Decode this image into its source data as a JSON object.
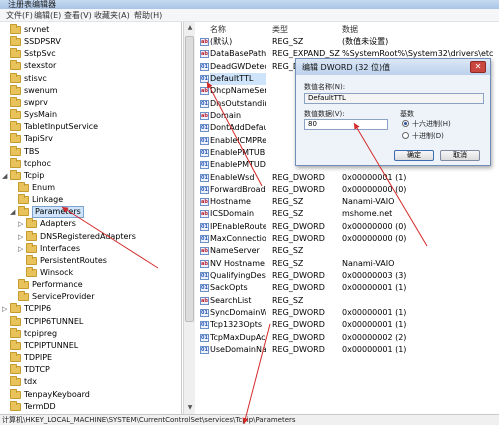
{
  "window": {
    "title": "注册表编辑器"
  },
  "menu": [
    "文件(F)",
    "编辑(E)",
    "查看(V)",
    "收藏夹(A)",
    "帮助(H)"
  ],
  "tree": [
    {
      "label": "srvnet",
      "depth": 0,
      "arrow": ""
    },
    {
      "label": "SSDPSRV",
      "depth": 0,
      "arrow": ""
    },
    {
      "label": "SstpSvc",
      "depth": 0,
      "arrow": ""
    },
    {
      "label": "stexstor",
      "depth": 0,
      "arrow": ""
    },
    {
      "label": "stisvc",
      "depth": 0,
      "arrow": ""
    },
    {
      "label": "swenum",
      "depth": 0,
      "arrow": ""
    },
    {
      "label": "swprv",
      "depth": 0,
      "arrow": ""
    },
    {
      "label": "SysMain",
      "depth": 0,
      "arrow": ""
    },
    {
      "label": "TabletInputService",
      "depth": 0,
      "arrow": ""
    },
    {
      "label": "TapiSrv",
      "depth": 0,
      "arrow": ""
    },
    {
      "label": "TBS",
      "depth": 0,
      "arrow": ""
    },
    {
      "label": "tcphoc",
      "depth": 0,
      "arrow": ""
    },
    {
      "label": "Tcpip",
      "depth": 0,
      "arrow": "◢"
    },
    {
      "label": "Enum",
      "depth": 1,
      "arrow": ""
    },
    {
      "label": "Linkage",
      "depth": 1,
      "arrow": ""
    },
    {
      "label": "Parameters",
      "depth": 1,
      "arrow": "◢",
      "selected": true
    },
    {
      "label": "Adapters",
      "depth": 2,
      "arrow": "▷"
    },
    {
      "label": "DNSRegisteredAdapters",
      "depth": 2,
      "arrow": "▷"
    },
    {
      "label": "Interfaces",
      "depth": 2,
      "arrow": "▷"
    },
    {
      "label": "PersistentRoutes",
      "depth": 2,
      "arrow": ""
    },
    {
      "label": "Winsock",
      "depth": 2,
      "arrow": ""
    },
    {
      "label": "Performance",
      "depth": 1,
      "arrow": ""
    },
    {
      "label": "ServiceProvider",
      "depth": 1,
      "arrow": ""
    },
    {
      "label": "TCPIP6",
      "depth": 0,
      "arrow": "▷"
    },
    {
      "label": "TCPIP6TUNNEL",
      "depth": 0,
      "arrow": ""
    },
    {
      "label": "tcpipreg",
      "depth": 0,
      "arrow": ""
    },
    {
      "label": "TCPIPTUNNEL",
      "depth": 0,
      "arrow": ""
    },
    {
      "label": "TDPIPE",
      "depth": 0,
      "arrow": ""
    },
    {
      "label": "TDTCP",
      "depth": 0,
      "arrow": ""
    },
    {
      "label": "tdx",
      "depth": 0,
      "arrow": ""
    },
    {
      "label": "TenpayKeyboard",
      "depth": 0,
      "arrow": ""
    },
    {
      "label": "TermDD",
      "depth": 0,
      "arrow": ""
    }
  ],
  "list": {
    "headers": {
      "name": "名称",
      "type": "类型",
      "data": "数据"
    },
    "rows": [
      {
        "name": "(默认)",
        "type": "REG_SZ",
        "data": "(数值未设置)",
        "icon": "ab"
      },
      {
        "name": "DataBasePath",
        "type": "REG_EXPAND_SZ",
        "data": "%SystemRoot%\\System32\\drivers\\etc",
        "icon": "ab"
      },
      {
        "name": "DeadGWDetec...",
        "type": "REG_DWORD",
        "data": "",
        "icon": "bin"
      },
      {
        "name": "DefaultTTL",
        "type": "",
        "data": "",
        "icon": "bin",
        "selected": true
      },
      {
        "name": "DhcpNameSer...",
        "type": "",
        "data": "",
        "icon": "ab"
      },
      {
        "name": "DnsOutstandin...",
        "type": "",
        "data": "",
        "icon": "bin"
      },
      {
        "name": "Domain",
        "type": "",
        "data": "",
        "icon": "ab"
      },
      {
        "name": "DontAddDefau...",
        "type": "",
        "data": "",
        "icon": "bin"
      },
      {
        "name": "EnableICMPRe...",
        "type": "",
        "data": "",
        "icon": "bin"
      },
      {
        "name": "EnablePMTUBI...",
        "type": "",
        "data": "",
        "icon": "bin"
      },
      {
        "name": "EnablePMTUDi...",
        "type": "",
        "data": "",
        "icon": "bin"
      },
      {
        "name": "EnableWsd",
        "type": "REG_DWORD",
        "data": "0x00000001 (1)",
        "icon": "bin"
      },
      {
        "name": "ForwardBroad...",
        "type": "REG_DWORD",
        "data": "0x00000000 (0)",
        "icon": "bin"
      },
      {
        "name": "Hostname",
        "type": "REG_SZ",
        "data": "Nanami-VAIO",
        "icon": "ab"
      },
      {
        "name": "ICSDomain",
        "type": "REG_SZ",
        "data": "mshome.net",
        "icon": "ab"
      },
      {
        "name": "IPEnableRouter",
        "type": "REG_DWORD",
        "data": "0x00000000 (0)",
        "icon": "bin"
      },
      {
        "name": "MaxConnectio...",
        "type": "REG_DWORD",
        "data": "0x00000000 (0)",
        "icon": "bin"
      },
      {
        "name": "NameServer",
        "type": "REG_SZ",
        "data": "",
        "icon": "ab"
      },
      {
        "name": "NV Hostname",
        "type": "REG_SZ",
        "data": "Nanami-VAIO",
        "icon": "ab"
      },
      {
        "name": "QualifyingDesti...",
        "type": "REG_DWORD",
        "data": "0x00000003 (3)",
        "icon": "bin"
      },
      {
        "name": "SackOpts",
        "type": "REG_DWORD",
        "data": "0x00000001 (1)",
        "icon": "bin"
      },
      {
        "name": "SearchList",
        "type": "REG_SZ",
        "data": "",
        "icon": "ab"
      },
      {
        "name": "SyncDomainWi...",
        "type": "REG_DWORD",
        "data": "0x00000001 (1)",
        "icon": "bin"
      },
      {
        "name": "Tcp1323Opts",
        "type": "REG_DWORD",
        "data": "0x00000001 (1)",
        "icon": "bin"
      },
      {
        "name": "TcpMaxDupAc...",
        "type": "REG_DWORD",
        "data": "0x00000002 (2)",
        "icon": "bin"
      },
      {
        "name": "UseDomainNa...",
        "type": "REG_DWORD",
        "data": "0x00000001 (1)",
        "icon": "bin"
      }
    ]
  },
  "status": "计算机\\HKEY_LOCAL_MACHINE\\SYSTEM\\CurrentControlSet\\services\\Tcpip\\Parameters",
  "dialog": {
    "title": "编辑 DWORD (32 位)值",
    "name_label": "数值名称(N):",
    "name_value": "DefaultTTL",
    "data_label": "数值数据(V):",
    "data_value": "80",
    "base_label": "基数",
    "hex_label": "十六进制(H)",
    "dec_label": "十进制(D)",
    "ok": "确定",
    "cancel": "取消"
  },
  "colors": {
    "annotation_arrow": "#d42a2a",
    "selection": "#cde4fb",
    "dialog_bg": "#eef3fa"
  }
}
